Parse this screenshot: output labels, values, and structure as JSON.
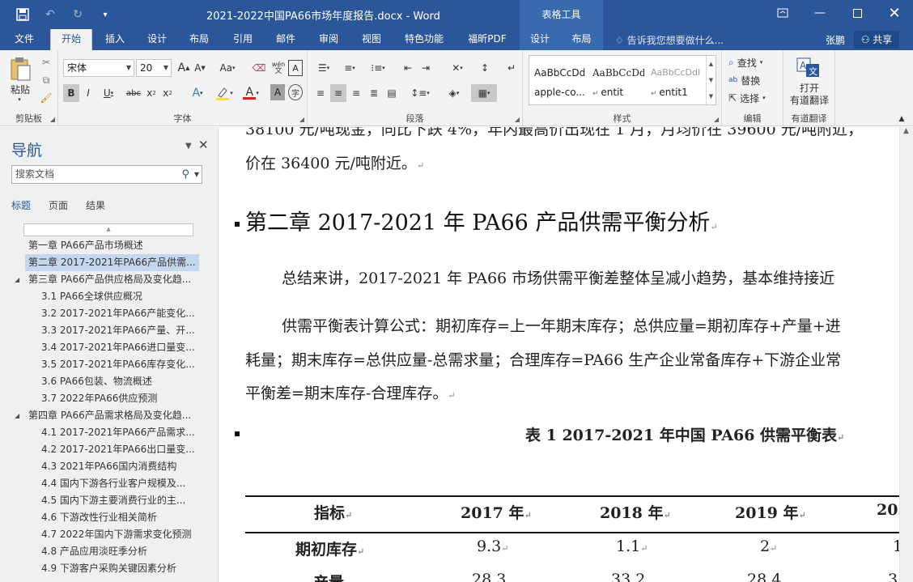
{
  "titlebar": {
    "title": "2021-2022中国PA66市场年度报告.docx - Word",
    "context_tab_group": "表格工具",
    "save_icon": "save-icon",
    "undo_icon": "undo-icon",
    "redo_icon": "redo-icon",
    "customize_icon": "customize-qat-icon"
  },
  "tabs": [
    {
      "label": "文件"
    },
    {
      "label": "开始"
    },
    {
      "label": "插入"
    },
    {
      "label": "设计"
    },
    {
      "label": "布局"
    },
    {
      "label": "引用"
    },
    {
      "label": "邮件"
    },
    {
      "label": "审阅"
    },
    {
      "label": "视图"
    },
    {
      "label": "特色功能"
    },
    {
      "label": "福昕PDF"
    },
    {
      "label": "设计"
    },
    {
      "label": "布局"
    }
  ],
  "tell_me": "告诉我您想要做什么...",
  "user_name": "张鹏",
  "share_label": "共享",
  "ribbon": {
    "clipboard": {
      "paste_label": "粘贴",
      "group_label": "剪贴板"
    },
    "font": {
      "font_name": "宋体",
      "font_size": "20",
      "group_label": "字体",
      "case_label": "Aa",
      "strike_label": "abc",
      "phonetic_label": "wén"
    },
    "paragraph": {
      "group_label": "段落"
    },
    "styles": {
      "group_label": "样式",
      "items": [
        {
          "preview": "AaBbCcDd",
          "name": "apple-co..."
        },
        {
          "preview": "AaBbCcDdI",
          "name": "entit"
        },
        {
          "preview": "AaBbCcDdI",
          "name": "entit1"
        }
      ]
    },
    "editing": {
      "find_label": "查找",
      "replace_label": "替换",
      "select_label": "选择",
      "group_label": "编辑"
    },
    "translate": {
      "button_line1": "打开",
      "button_line2": "有道翻译",
      "group_label": "有道翻译"
    }
  },
  "nav": {
    "title": "导航",
    "search_placeholder": "搜索文档",
    "tabs": [
      "标题",
      "页面",
      "结果"
    ],
    "items": [
      {
        "text": "第一章 PA66产品市场概述",
        "level": 1,
        "expand": ""
      },
      {
        "text": "第二章 2017-2021年PA66产品供需...",
        "level": 1,
        "expand": "",
        "selected": true
      },
      {
        "text": "第三章 PA66产品供应格局及变化趋...",
        "level": 1,
        "expand": "◢"
      },
      {
        "text": "3.1 PA66全球供应概况",
        "level": 2,
        "expand": ""
      },
      {
        "text": "3.2 2017-2021年PA66产能变化...",
        "level": 2,
        "expand": ""
      },
      {
        "text": "3.3 2017-2021年PA66产量、开...",
        "level": 2,
        "expand": ""
      },
      {
        "text": "3.4 2017-2021年PA66进口量变...",
        "level": 2,
        "expand": ""
      },
      {
        "text": "3.5 2017-2021年PA66库存变化...",
        "level": 2,
        "expand": ""
      },
      {
        "text": "3.6 PA66包装、物流概述",
        "level": 2,
        "expand": ""
      },
      {
        "text": "3.7 2022年PA66供应预测",
        "level": 2,
        "expand": ""
      },
      {
        "text": "第四章 PA66产品需求格局及变化趋...",
        "level": 1,
        "expand": "◢"
      },
      {
        "text": "4.1 2017-2021年PA66产品需求...",
        "level": 2,
        "expand": ""
      },
      {
        "text": "4.2 2017-2021年PA66出口量变...",
        "level": 2,
        "expand": ""
      },
      {
        "text": "4.3 2021年PA66国内消费结构",
        "level": 2,
        "expand": ""
      },
      {
        "text": "4.4 国内下游各行业客户规模及...",
        "level": 2,
        "expand": ""
      },
      {
        "text": "4.5 国内下游主要消费行业的主...",
        "level": 2,
        "expand": ""
      },
      {
        "text": "4.6 下游改性行业相关简析",
        "level": 2,
        "expand": ""
      },
      {
        "text": "4.7 2022年国内下游需求变化预测",
        "level": 2,
        "expand": ""
      },
      {
        "text": "4.8 产品应用淡旺季分析",
        "level": 2,
        "expand": ""
      },
      {
        "text": "4.9 下游客户采购关键因素分析",
        "level": 2,
        "expand": ""
      }
    ]
  },
  "document": {
    "line_top_cut": "38100 元/吨现金，同比下跌 4%，年内最高价出现在 1 月，月均价在 39600 元/吨附近，",
    "line_price": "价在 36400 元/吨附近。",
    "heading": "第二章 2017-2021 年 PA66 产品供需平衡分析",
    "para1": "总结来讲，2017-2021 年 PA66 市场供需平衡差整体呈减小趋势，基本维持接近",
    "para2_line1": "供需平衡表计算公式：期初库存=上一年期末库存；总供应量=期初库存+产量+进",
    "para2_line2": "耗量；期末库存=总供应量-总需求量；合理库存=PA66 生产企业常备库存+下游企业常",
    "para2_line3": "平衡差=期末库存-合理库存。",
    "table_caption": "表 1 2017-2021 年中国 PA66 供需平衡表",
    "table_headers": [
      "指标",
      "2017 年",
      "2018 年",
      "2019 年",
      "202"
    ],
    "table_row1": [
      "期初库存",
      "9.3",
      "1.1",
      "2",
      "1"
    ],
    "table_row2": [
      "产量",
      "28.3",
      "33.2",
      "28.4",
      "3"
    ],
    "para_mark": "↵"
  }
}
